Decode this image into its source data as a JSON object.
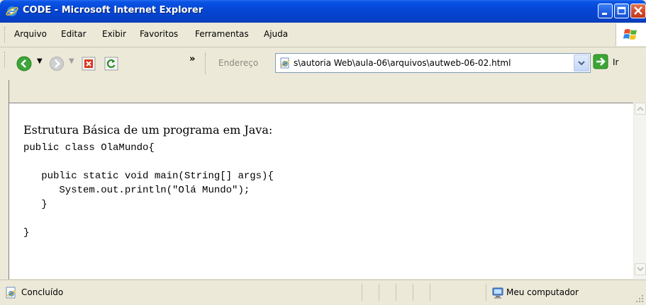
{
  "window": {
    "title": "CODE - Microsoft Internet Explorer"
  },
  "menu": {
    "items": [
      "Arquivo",
      "Editar",
      "Exibir",
      "Favoritos",
      "Ferramentas",
      "Ajuda"
    ]
  },
  "toolbar": {
    "more": "»",
    "address_label": "Endereço",
    "address_value": "s\\autoria Web\\aula-06\\arquivos\\autweb-06-02.html",
    "go_label": "Ir"
  },
  "page": {
    "heading": "Estrutura Básica de um programa em Java:",
    "code": "public class OlaMundo{\n\n   public static void main(String[] args){\n      System.out.println(\"Olá Mundo\");\n   }\n\n}"
  },
  "status": {
    "text": "Concluído",
    "zone": "Meu computador"
  },
  "colors": {
    "titlebar": "#0546D6",
    "chrome": "#ECE9D8",
    "close": "#D4472A"
  }
}
